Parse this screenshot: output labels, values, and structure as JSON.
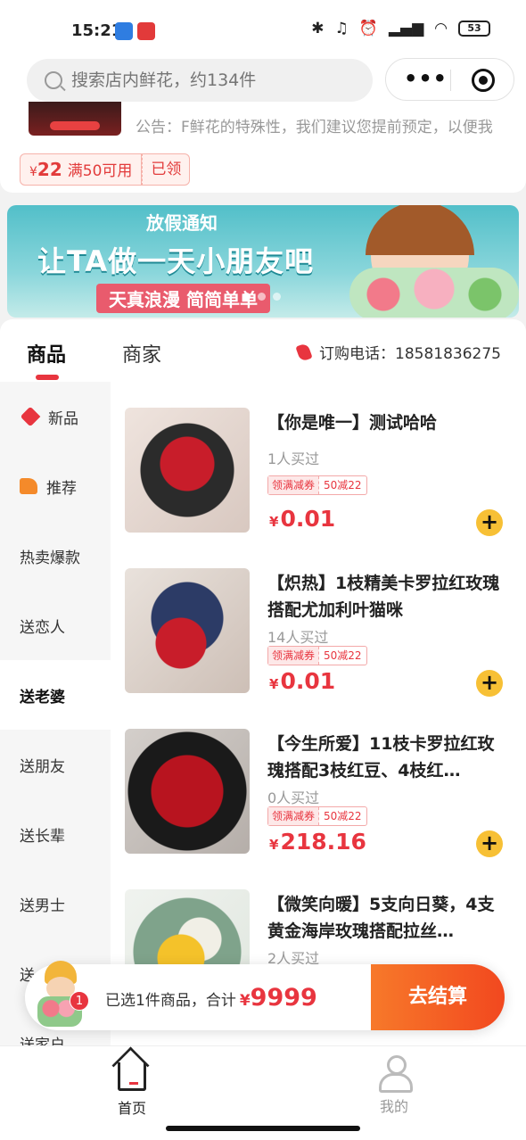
{
  "status_bar": {
    "time": "15:21",
    "battery": "53"
  },
  "search": {
    "placeholder": "搜索店内鲜花，约134件"
  },
  "notice": "公告：F鲜花的特殊性，我们建议您提前预定，以便我",
  "coupon": {
    "currency": "¥",
    "amount": "22",
    "condition": "满50可用",
    "status": "已领"
  },
  "banner": {
    "top": "放假通知",
    "title": "让TA做一天小朋友吧",
    "subtitle": "天真浪漫 简简单单"
  },
  "tabs": [
    {
      "label": "商品",
      "active": true
    },
    {
      "label": "商家",
      "active": false
    }
  ],
  "phone": {
    "label": "订购电话：18581836275"
  },
  "categories": [
    {
      "label": "新品",
      "icon": "tag-icon"
    },
    {
      "label": "推荐",
      "icon": "thumbs-up-icon"
    },
    {
      "label": "热卖爆款"
    },
    {
      "label": "送恋人"
    },
    {
      "label": "送老婆",
      "active": true
    },
    {
      "label": "送朋友"
    },
    {
      "label": "送长辈"
    },
    {
      "label": "送男士"
    },
    {
      "label": "送"
    },
    {
      "label": "送家户"
    }
  ],
  "promo": {
    "left": "领满减券",
    "right": "50减22"
  },
  "products": [
    {
      "name": "【你是唯一】测试哈哈",
      "sold": "1人买过",
      "currency": "¥",
      "price": "0.01"
    },
    {
      "name": "【炽热】1枝精美卡罗拉红玫瑰搭配尤加利叶猫咪",
      "sold": "14人买过",
      "currency": "¥",
      "price": "0.01"
    },
    {
      "name": "【今生所爱】11枝卡罗拉红玫瑰搭配3枝红豆、4枝红…",
      "sold": "0人买过",
      "currency": "¥",
      "price": "218.16"
    },
    {
      "name": "【微笑向暖】5支向日葵，4支黄金海岸玫瑰搭配拉丝…",
      "sold": "2人买过"
    }
  ],
  "cart": {
    "badge": "1",
    "text": "已选1件商品，合计",
    "currency": "¥",
    "total": "9999",
    "checkout": "去结算"
  },
  "bottom_nav": [
    {
      "label": "首页",
      "active": true
    },
    {
      "label": "我的",
      "active": false
    }
  ]
}
